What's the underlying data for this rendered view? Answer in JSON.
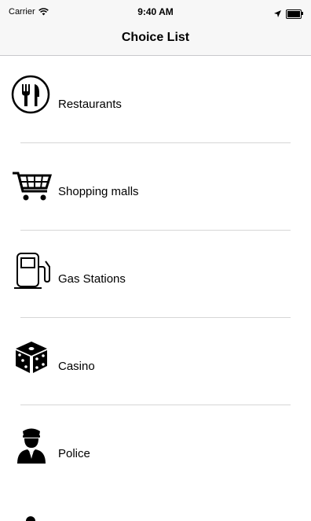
{
  "status_bar": {
    "carrier": "Carrier",
    "time": "9:40 AM",
    "battery_level": 1.0
  },
  "nav": {
    "title": "Choice List"
  },
  "items": [
    {
      "label": "Restaurants",
      "icon": "restaurant-icon"
    },
    {
      "label": "Shopping malls",
      "icon": "shopping-cart-icon"
    },
    {
      "label": "Gas Stations",
      "icon": "gas-station-icon"
    },
    {
      "label": "Casino",
      "icon": "dice-icon"
    },
    {
      "label": "Police",
      "icon": "police-officer-icon"
    }
  ]
}
